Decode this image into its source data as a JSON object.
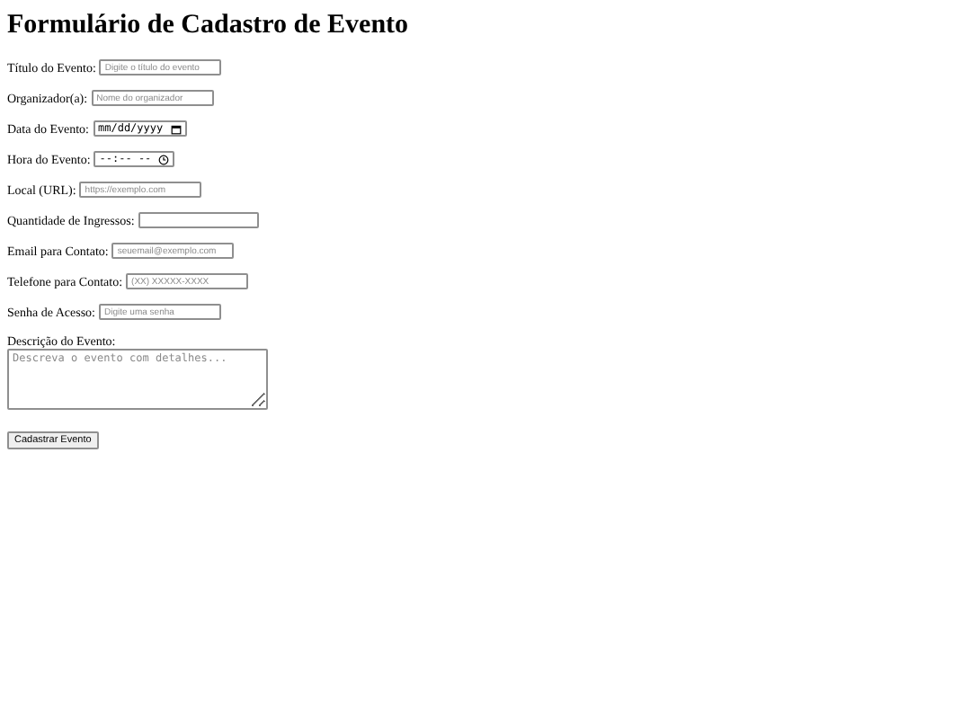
{
  "title": "Formulário de Cadastro de Evento",
  "fields": [
    {
      "kind": "text",
      "label": "Título do Evento:",
      "placeholder": "Digite o título do evento"
    },
    {
      "kind": "text",
      "label": "Organizador(a):",
      "placeholder": "Nome do organizador"
    },
    {
      "kind": "date",
      "label": "Data do Evento:",
      "value": "mm/dd/yyyy"
    },
    {
      "kind": "time",
      "label": "Hora do Evento:",
      "value": "--:-- --"
    },
    {
      "kind": "text",
      "label": "Local (URL):",
      "placeholder": "https://exemplo.com"
    },
    {
      "kind": "number",
      "label": "Quantidade de Ingressos:"
    },
    {
      "kind": "text",
      "label": "Email para Contato:",
      "placeholder": "seuemail@exemplo.com"
    },
    {
      "kind": "text",
      "label": "Telefone para Contato:",
      "placeholder": "(XX) XXXXX-XXXX"
    },
    {
      "kind": "text",
      "label": "Senha de Acesso:",
      "placeholder": "Digite uma senha"
    },
    {
      "kind": "textarea",
      "label": "Descrição do Evento:",
      "placeholder": "Descreva o evento com detalhes..."
    }
  ],
  "submit": "Cadastrar Evento"
}
